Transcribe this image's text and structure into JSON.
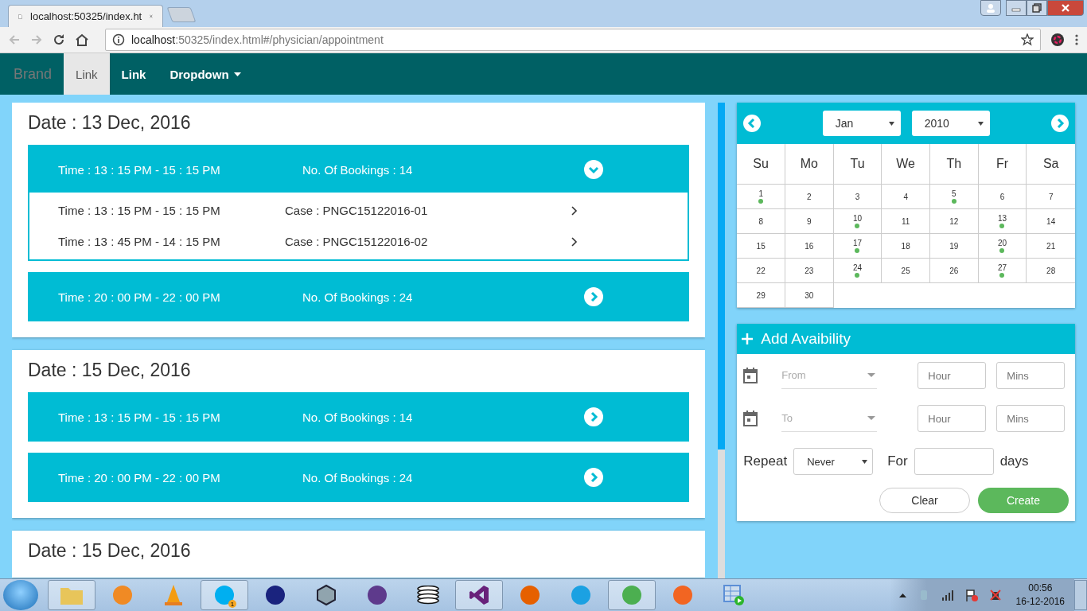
{
  "browser": {
    "tab_title": "localhost:50325/index.ht",
    "address_host": "localhost",
    "address_path": ":50325/index.html#/physician/appointment"
  },
  "navbar": {
    "brand": "Brand",
    "links": [
      {
        "label": "Link",
        "selected": true,
        "kind": "link"
      },
      {
        "label": "Link",
        "selected": false,
        "kind": "link"
      },
      {
        "label": "Dropdown",
        "selected": false,
        "kind": "dropdown"
      }
    ]
  },
  "days": [
    {
      "date": "Date : 13 Dec, 2016",
      "slots": [
        {
          "time": "Time : 13 : 15 PM - 15 : 15 PM",
          "bookings": "No. Of Bookings : 14",
          "expanded": true,
          "cases": [
            {
              "time": "Time : 13 : 15 PM - 15 : 15 PM",
              "case": "Case : PNGC15122016-01"
            },
            {
              "time": "Time : 13 : 45 PM - 14 : 15 PM",
              "case": "Case : PNGC15122016-02"
            }
          ]
        },
        {
          "time": "Time : 20 : 00 PM - 22 : 00 PM",
          "bookings": "No. Of Bookings : 24",
          "expanded": false
        }
      ]
    },
    {
      "date": "Date : 15 Dec, 2016",
      "slots": [
        {
          "time": "Time : 13 : 15 PM - 15 : 15 PM",
          "bookings": "No. Of Bookings : 14",
          "expanded": false
        },
        {
          "time": "Time : 20 : 00 PM - 22 : 00 PM",
          "bookings": "No. Of Bookings : 24",
          "expanded": false
        }
      ]
    },
    {
      "date": "Date : 15 Dec, 2016"
    }
  ],
  "calendar": {
    "month": "Jan",
    "year": "2010",
    "weekdays": [
      "Su",
      "Mo",
      "Tu",
      "We",
      "Th",
      "Fr",
      "Sa"
    ],
    "days": [
      {
        "label": "1",
        "has_event": true
      },
      {
        "label": "2",
        "has_event": false
      },
      {
        "label": "3",
        "has_event": false
      },
      {
        "label": "4",
        "has_event": false
      },
      {
        "label": "5",
        "has_event": true
      },
      {
        "label": "6",
        "has_event": false
      },
      {
        "label": "7",
        "has_event": false
      },
      {
        "label": "8",
        "has_event": false
      },
      {
        "label": "9",
        "has_event": false
      },
      {
        "label": "10",
        "has_event": true
      },
      {
        "label": "11",
        "has_event": false
      },
      {
        "label": "12",
        "has_event": false
      },
      {
        "label": "13",
        "has_event": true
      },
      {
        "label": "14",
        "has_event": false
      },
      {
        "label": "15",
        "has_event": false
      },
      {
        "label": "16",
        "has_event": false
      },
      {
        "label": "17",
        "has_event": true
      },
      {
        "label": "18",
        "has_event": false
      },
      {
        "label": "19",
        "has_event": false
      },
      {
        "label": "20",
        "has_event": true
      },
      {
        "label": "21",
        "has_event": false
      },
      {
        "label": "22",
        "has_event": false
      },
      {
        "label": "23",
        "has_event": false
      },
      {
        "label": "24",
        "has_event": true
      },
      {
        "label": "25",
        "has_event": false
      },
      {
        "label": "26",
        "has_event": false
      },
      {
        "label": "27",
        "has_event": true
      },
      {
        "label": "28",
        "has_event": false
      },
      {
        "label": "29",
        "has_event": false
      },
      {
        "label": "30",
        "has_event": false
      }
    ]
  },
  "availability": {
    "title": "Add Avaibility",
    "rows": [
      {
        "date": {
          "placeholder": "From"
        },
        "hour": {
          "placeholder": "Hour"
        },
        "mins": {
          "placeholder": "Mins"
        }
      },
      {
        "date": {
          "placeholder": "To"
        },
        "hour": {
          "placeholder": "Hour"
        },
        "mins": {
          "placeholder": "Mins"
        }
      }
    ],
    "repeat_label": "Repeat",
    "repeat_value": "Never",
    "for_label": "For",
    "days_label": "days",
    "buttons": [
      {
        "label": "Clear",
        "kind": "secondary"
      },
      {
        "label": "Create",
        "kind": "primary"
      }
    ]
  },
  "taskbar": {
    "apps": [
      {
        "kind": "folder",
        "selected": true
      },
      {
        "kind": "media",
        "selected": false
      },
      {
        "kind": "cone",
        "selected": false
      },
      {
        "kind": "skype",
        "selected": true,
        "badge": "1"
      },
      {
        "kind": "slash",
        "selected": false
      },
      {
        "kind": "cube",
        "selected": false
      },
      {
        "kind": "sphere",
        "selected": false
      },
      {
        "kind": "database",
        "selected": false
      },
      {
        "kind": "vs",
        "selected": true
      },
      {
        "kind": "firefox",
        "selected": false
      },
      {
        "kind": "ie",
        "selected": false
      },
      {
        "kind": "chrome",
        "selected": true
      },
      {
        "kind": "tool",
        "selected": false
      },
      {
        "kind": "table",
        "selected": false
      }
    ],
    "time": "00:56",
    "date": "16-12-2016"
  }
}
